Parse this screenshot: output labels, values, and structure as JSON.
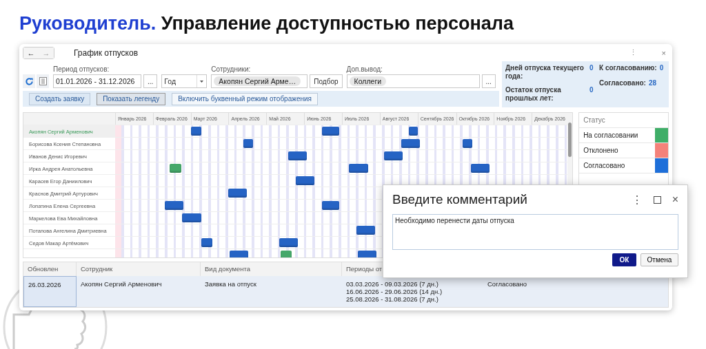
{
  "heading": {
    "accent": "Руководитель.",
    "text": "Управление доступностью персонала"
  },
  "window": {
    "title": "График отпусков",
    "nav": [
      "←",
      "→"
    ],
    "menu": "⋮",
    "close": "×"
  },
  "filters": {
    "period": {
      "label": "Период отпусков:",
      "value": "01.01.2026 - 31.12.2026",
      "more": "..."
    },
    "period_type": {
      "value": "Год"
    },
    "employees": {
      "label": "Сотрудники:",
      "tag": "Акопян Сергий Арме…",
      "pick": "Подбор"
    },
    "extra": {
      "label": "Доп.вывод:",
      "tag": "Коллеги",
      "more": "..."
    }
  },
  "actions": [
    {
      "label": "Создать заявку",
      "pressed": false
    },
    {
      "label": "Показать легенду",
      "pressed": true
    },
    {
      "label": "Включить буквенный режим отображения",
      "pressed": false
    }
  ],
  "summary": [
    {
      "label": "Дней отпуска текущего года:",
      "value": "0"
    },
    {
      "label": "Остаток отпуска прошлых лет:",
      "value": "0"
    },
    {
      "label": "К согласованию:",
      "value": "0"
    },
    {
      "label": "Согласовано:",
      "value": "28"
    }
  ],
  "gantt": {
    "months": [
      "Январь 2026",
      "Февраль 2026",
      "Март 2026",
      "Апрель 2026",
      "Май 2026",
      "Июнь 2026",
      "Июль 2026",
      "Август 2026",
      "Сентябрь 2026",
      "Октябрь 2026",
      "Ноябрь 2026",
      "Декабрь 2026"
    ],
    "rows": [
      {
        "name": "Акопян Сергий Арменович",
        "selected": true,
        "bars": [
          {
            "color": "#2563c4"
          },
          {
            "color": "#2563c4"
          },
          {
            "color": "#2563c4"
          }
        ]
      },
      {
        "name": "Борисова Ксения Степановна",
        "selected": false,
        "bars": [
          {
            "color": "#2563c4"
          },
          {
            "color": "#2563c4"
          },
          {
            "color": "#2563c4"
          }
        ]
      },
      {
        "name": "Иванов Денис Игоревич",
        "selected": false,
        "bars": [
          {
            "color": "#2563c4"
          },
          {
            "color": "#2563c4"
          }
        ]
      },
      {
        "name": "Ирка Андрея Анатольевна",
        "selected": false,
        "bars": [
          {
            "color": "#45a86a"
          },
          {
            "color": "#2563c4"
          },
          {
            "color": "#2563c4"
          }
        ]
      },
      {
        "name": "Карасев Егор Даниилович",
        "selected": false,
        "bars": [
          {
            "color": "#2563c4"
          }
        ]
      },
      {
        "name": "Краснов Дмитрий Артурович",
        "selected": false,
        "bars": [
          {
            "color": "#2563c4"
          }
        ]
      },
      {
        "name": "Лопатина Елена Сергеевна",
        "selected": false,
        "bars": [
          {
            "color": "#2563c4"
          },
          {
            "color": "#2563c4"
          }
        ]
      },
      {
        "name": "Маркелова Ева Михайловна",
        "selected": false,
        "bars": [
          {
            "color": "#2563c4"
          }
        ]
      },
      {
        "name": "Потапова Ангелина Дмитриевна",
        "selected": false,
        "bars": [
          {
            "color": "#2563c4"
          }
        ]
      },
      {
        "name": "Седов Макар Артёмович",
        "selected": false,
        "bars": [
          {
            "color": "#2563c4"
          },
          {
            "color": "#2563c4"
          }
        ]
      },
      {
        "selected": false,
        "bars": [
          {
            "color": "#2563c4"
          },
          {
            "color": "#45a86a"
          },
          {
            "color": "#2563c4"
          }
        ]
      }
    ]
  },
  "legend": {
    "title": "Статус",
    "items": [
      {
        "label": "На согласовании",
        "color": "#3fae68"
      },
      {
        "label": "Отклонено",
        "color": "#f4827a"
      },
      {
        "label": "Согласовано",
        "color": "#1e6fd9"
      }
    ]
  },
  "table": {
    "columns": [
      "Обновлен",
      "Сотрудник",
      "Вид документа",
      "Периоды от"
    ],
    "rows": [
      {
        "updated": "26.03.2026",
        "employee": "Акопян Сергий Арменович",
        "document": "Заявка на отпуск",
        "periods": [
          "03.03.2026 - 09.03.2026 (7 дн.)",
          "16.06.2026 - 29.06.2026 (14 дн.)",
          "25.08.2026 - 31.08.2026 (7 дн.)"
        ],
        "status": "Согласовано",
        "selected": true
      }
    ]
  },
  "dialog": {
    "title": "Введите комментарий",
    "menu": "⋮",
    "close": "×",
    "value": "Необходимо перенести даты отпуска",
    "ok": "ОК",
    "cancel": "Отмена"
  }
}
